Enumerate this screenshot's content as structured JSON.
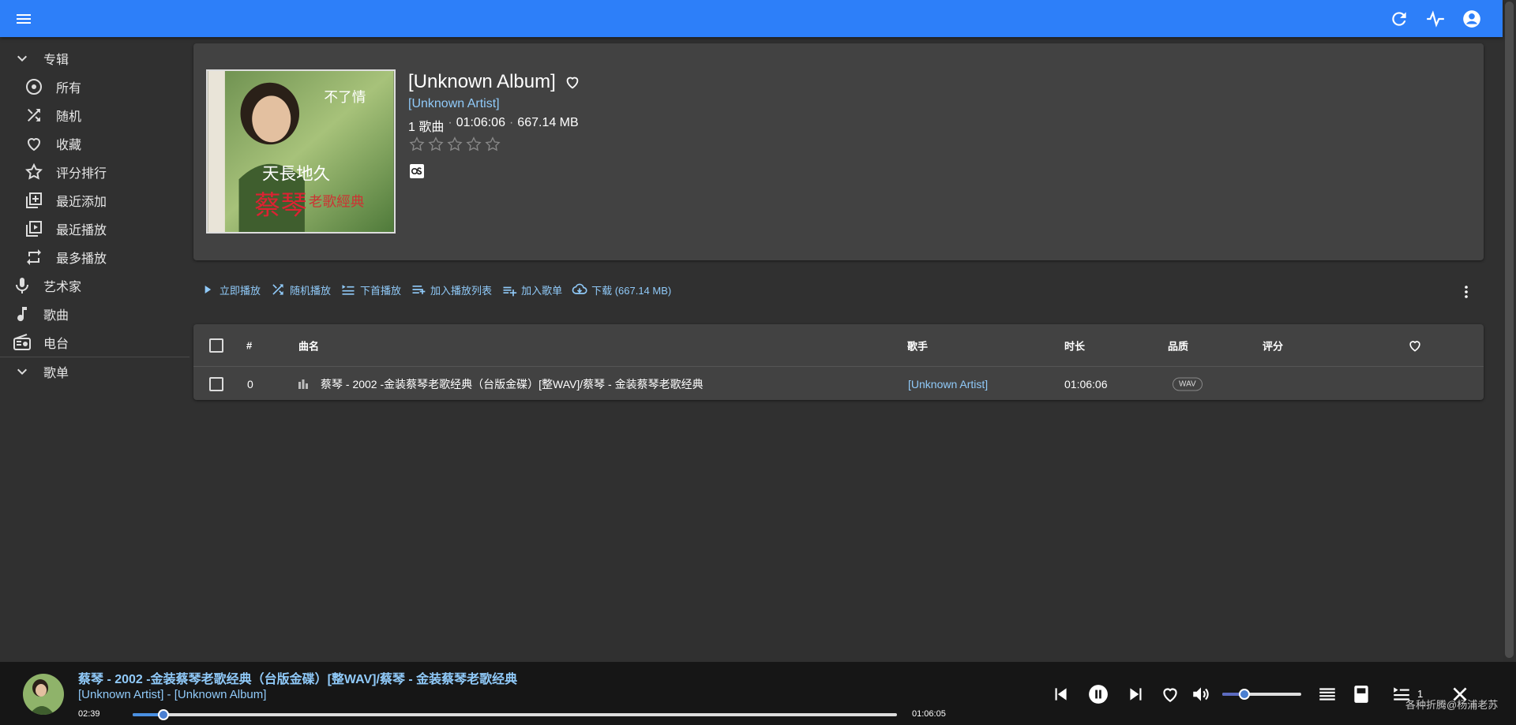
{
  "colors": {
    "accent": "#2d7ff9",
    "link": "#90caf9",
    "background": "#303030",
    "card": "#424242"
  },
  "topbar": {
    "menu_icon": "menu-icon",
    "icons": [
      "refresh-icon",
      "activity-icon",
      "account-icon"
    ]
  },
  "sidebar": {
    "items": [
      {
        "label": "专辑",
        "icon": "chevron-down-icon",
        "level": 0
      },
      {
        "label": "所有",
        "icon": "album-icon",
        "level": 1
      },
      {
        "label": "随机",
        "icon": "shuffle-icon",
        "level": 1
      },
      {
        "label": "收藏",
        "icon": "heart-icon",
        "level": 1
      },
      {
        "label": "评分排行",
        "icon": "star-icon",
        "level": 1
      },
      {
        "label": "最近添加",
        "icon": "library-add-icon",
        "level": 1
      },
      {
        "label": "最近播放",
        "icon": "library-play-icon",
        "level": 1
      },
      {
        "label": "最多播放",
        "icon": "repeat-icon",
        "level": 1
      },
      {
        "label": "艺术家",
        "icon": "mic-icon",
        "level": 0
      },
      {
        "label": "歌曲",
        "icon": "music-note-icon",
        "level": 0
      },
      {
        "label": "电台",
        "icon": "radio-icon",
        "level": 0
      },
      {
        "label": "歌单",
        "icon": "chevron-down-icon",
        "level": 0
      }
    ]
  },
  "album": {
    "title": "[Unknown Album]",
    "artist": "[Unknown Artist]",
    "song_count": "1 歌曲",
    "duration": "01:06:06",
    "size": "667.14 MB",
    "rating": 0,
    "rating_max": 5,
    "cover_text": {
      "top": "不了情",
      "name": "蔡琴",
      "sub": "老歌經典",
      "banner": "天長地久"
    }
  },
  "actions": [
    {
      "label": "立即播放",
      "icon": "play-icon"
    },
    {
      "label": "随机播放",
      "icon": "shuffle-icon"
    },
    {
      "label": "下首播放",
      "icon": "play-next-icon"
    },
    {
      "label": "加入播放列表",
      "icon": "queue-add-icon"
    },
    {
      "label": "加入歌单",
      "icon": "playlist-add-icon"
    },
    {
      "label": "下载 (667.14 MB)",
      "icon": "download-icon"
    }
  ],
  "table": {
    "headers": {
      "num": "#",
      "title": "曲名",
      "artist": "歌手",
      "duration": "时长",
      "quality": "品质",
      "rating": "评分"
    },
    "rows": [
      {
        "num": "0",
        "title": "蔡琴 - 2002 -金装蔡琴老歌经典（台版金碟）[整WAV]/蔡琴 - 金装蔡琴老歌经典",
        "artist": "[Unknown Artist]",
        "duration": "01:06:06",
        "quality": "WAV"
      }
    ]
  },
  "player": {
    "title": "蔡琴 - 2002 -金装蔡琴老歌经典（台版金碟）[整WAV]/蔡琴 - 金装蔡琴老歌经典",
    "subtitle": "[Unknown Artist] - [Unknown Album]",
    "current_time": "02:39",
    "total_time": "01:06:05",
    "progress": 0.04,
    "volume": 0.28,
    "queue_count": "1",
    "watermark": "各种折腾@杨浦老苏"
  }
}
